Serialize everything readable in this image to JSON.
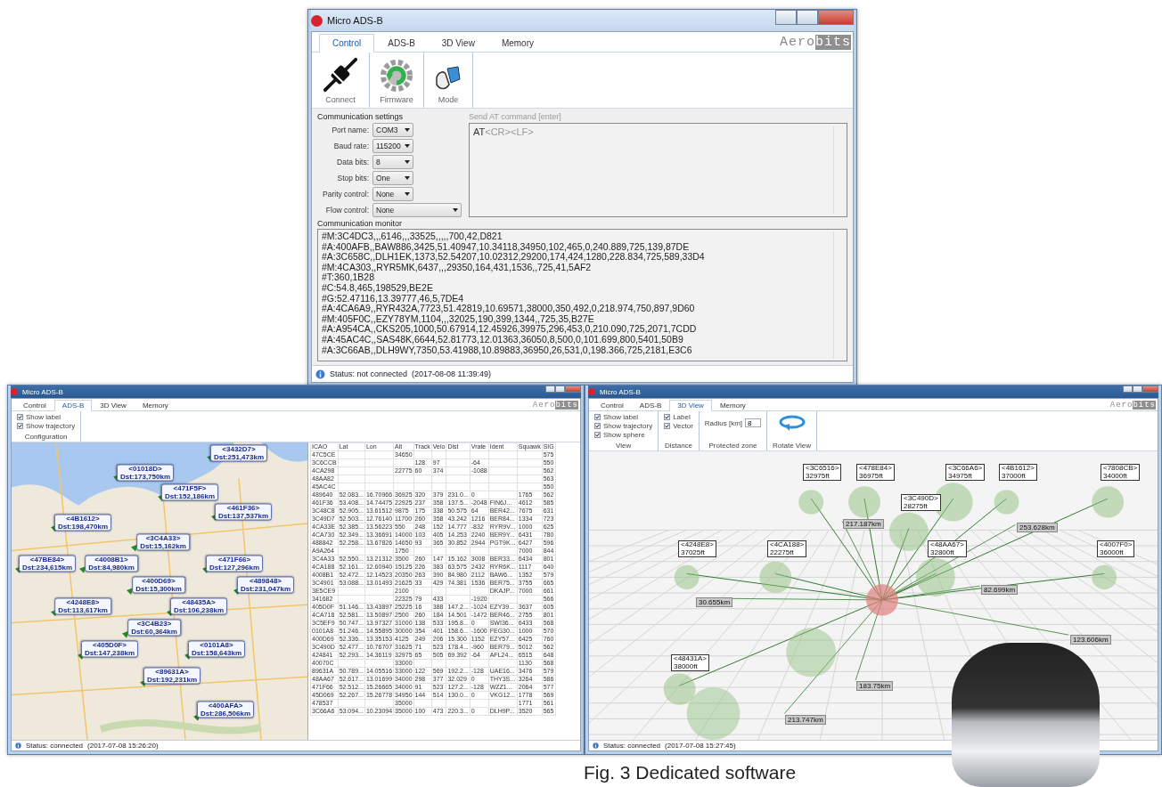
{
  "control_window": {
    "title": "Micro ADS-B",
    "logo": [
      "Aero",
      "bits"
    ],
    "tabs": [
      {
        "label": "Control",
        "selected": true
      },
      {
        "label": "ADS-B",
        "selected": false
      },
      {
        "label": "3D View",
        "selected": false
      },
      {
        "label": "Memory",
        "selected": false
      }
    ],
    "ribbon": [
      {
        "kind": "connect",
        "label": "Connect"
      },
      {
        "kind": "firmware",
        "label": "Firmware"
      },
      {
        "kind": "mode",
        "label": "Mode"
      }
    ],
    "settings_title": "Communication settings",
    "fields": [
      {
        "label": "Port name:",
        "value": "COM3",
        "kind": "narrow"
      },
      {
        "label": "Baud rate:",
        "value": "115200",
        "kind": "narrow"
      },
      {
        "label": "Data bits:",
        "value": "8",
        "kind": "narrow"
      },
      {
        "label": "Stop bits:",
        "value": "One",
        "kind": "narrow"
      },
      {
        "label": "Parity control:",
        "value": "None",
        "kind": "narrow"
      },
      {
        "label": "Flow control:",
        "value": "None",
        "kind": "wide"
      }
    ],
    "at_command": {
      "label": "Send AT command [enter]",
      "value": "AT",
      "suffix": "<CR><LF>"
    },
    "monitor_title": "Communication monitor",
    "monitor_lines": [
      "#M:3C4DC3,,,6146,,,33525,,,,,700,42,D821",
      "#A:400AFB,,BAW886,3425,51.40947,10.34118,34950,102,465,0,240.889,725,139,87DE",
      "#A:3C658C,,DLH1EK,1373,52.54207,10.02312,29200,174,424,1280,228.834,725,589,33D4",
      "#M:4CA303,,RYR5MK,6437,,,29350,164,431,1536,,725,41,5AF2",
      "#T:360,1B28",
      "#C:54.8,465,198529,BE2E",
      "#G:52.47116,13.39777,46,5,7DE4",
      "#A:4CA6A9,,RYR432A,7723,51.42819,10.69571,38000,350,492,0,218.974,750,897,9D60",
      "#M:405F0C,,EZY78YM,1104,,,32025,190,399,1344,,725,35,B27E",
      "#A:A954CA,,CKS205,1000,50.67914,12.45926,39975,296,453,0,210.090,725,2071,7CDD",
      "#A:45AC4C,,SAS48K,6644,52.81773,12.01363,36050,8,500,0,101.699,800,5401,50B9",
      "#A:3C66AB,,DLH9WY,7350,53.41988,10.89883,36950,26,531,0,198.366,725,2181,E3C6"
    ],
    "status": {
      "text": "Status: not connected",
      "time": "(2017-08-08 11:39:49)"
    }
  },
  "map_window": {
    "title": "Micro ADS-B",
    "logo": [
      "Aero",
      "bits"
    ],
    "tabs": [
      {
        "label": "Control",
        "selected": false
      },
      {
        "label": "ADS-B",
        "selected": true
      },
      {
        "label": "3D View",
        "selected": false
      },
      {
        "label": "Memory",
        "selected": false
      }
    ],
    "options": [
      {
        "label": "Show label",
        "checked": true
      },
      {
        "label": "Show trajectory",
        "checked": true
      }
    ],
    "group_label": "Configuration",
    "aircraft": [
      {
        "icao": "<3432D7>",
        "dist": "Dst:251,473km"
      },
      {
        "icao": "<01018D>",
        "dist": "Dst:173,750km"
      },
      {
        "icao": "<471F5F>",
        "dist": "Dst:152,186km"
      },
      {
        "icao": "<461F36>",
        "dist": "Dst:137,537km"
      },
      {
        "icao": "<4B1612>",
        "dist": "Dst:198,470km"
      },
      {
        "icao": "<3C4A33>",
        "dist": "Dst:15,162km"
      },
      {
        "icao": "<47BE84>",
        "dist": "Dst:234,615km"
      },
      {
        "icao": "<4008B1>",
        "dist": "Dst:84,980km"
      },
      {
        "icao": "<471F66>",
        "dist": "Dst:127,296km"
      },
      {
        "icao": "<400D69>",
        "dist": "Dst:15,300km"
      },
      {
        "icao": "<489848>",
        "dist": "Dst:231,047km"
      },
      {
        "icao": "<4248E8>",
        "dist": "Dst:113,617km"
      },
      {
        "icao": "<48435A>",
        "dist": "Dst:106,238km"
      },
      {
        "icao": "<3C4B23>",
        "dist": "Dst:60,364km"
      },
      {
        "icao": "<405D0F>",
        "dist": "Dst:147,238km"
      },
      {
        "icao": "<0101A8>",
        "dist": "Dst:158,643km"
      },
      {
        "icao": "<89631A>",
        "dist": "Dst:192,231km"
      },
      {
        "icao": "<400AFA>",
        "dist": "Dst:286,506km"
      }
    ],
    "table": {
      "columns": [
        "ICAO",
        "Lat",
        "Lon",
        "Alt",
        "Track",
        "Velo",
        "Dist",
        "Vrate",
        "Ident",
        "Squawk",
        "SIG"
      ],
      "rows": [
        [
          "47C5CE",
          "",
          "",
          "34650",
          "",
          "",
          "",
          "",
          "",
          "",
          "575"
        ],
        [
          "3C6CCB",
          "",
          "",
          "",
          "128",
          "97",
          "",
          "-64",
          "",
          "",
          "550"
        ],
        [
          "4CA298",
          "",
          "",
          "22775",
          "60",
          "374",
          "",
          "-1088",
          "",
          "",
          "562"
        ],
        [
          "48AA82",
          "",
          "",
          "",
          "",
          "",
          "",
          "",
          "",
          "",
          "563"
        ],
        [
          "45AC4C",
          "",
          "",
          "",
          "",
          "",
          "",
          "",
          "",
          "",
          "550"
        ],
        [
          "489640",
          "52.083...",
          "16.70966",
          "36925",
          "320",
          "379",
          "231.0...",
          "0",
          "",
          "1765",
          "562"
        ],
        [
          "461F36",
          "53.408...",
          "14.74475",
          "22925",
          "237",
          "358",
          "137.5...",
          "-2048",
          "FIN6J...",
          "4612",
          "585"
        ],
        [
          "3C48C8",
          "52.905...",
          "13.61512",
          "9875",
          "175",
          "338",
          "50.575",
          "64",
          "BER42...",
          "7675",
          "631"
        ],
        [
          "3C49D7",
          "52.503...",
          "12.76140",
          "11700",
          "260",
          "358",
          "43.242",
          "1216",
          "BER84...",
          "1334",
          "723"
        ],
        [
          "4CA33E",
          "52.385...",
          "13.56223",
          "550",
          "248",
          "152",
          "14.777",
          "-832",
          "RYR9V...",
          "1000",
          "625"
        ],
        [
          "4CA730",
          "52.349...",
          "13.36691",
          "14000",
          "103",
          "405",
          "14.253",
          "2240",
          "BER9Y...",
          "6431",
          "780"
        ],
        [
          "488842",
          "52.258...",
          "13.67826",
          "14650",
          "93",
          "365",
          "30.852",
          "2944",
          "PGT9K...",
          "6427",
          "596"
        ],
        [
          "A9A264",
          "",
          "",
          "1750",
          "",
          "",
          "",
          "",
          "",
          "7000",
          "844"
        ],
        [
          "3C4A33",
          "52.550...",
          "13.21312",
          "3500",
          "260",
          "147",
          "15.162",
          "3008",
          "BER33...",
          "6434",
          "801"
        ],
        [
          "4CA188",
          "52.161...",
          "12.60940",
          "15125",
          "226",
          "383",
          "63.575",
          "2432",
          "RYR6K...",
          "1117",
          "640"
        ],
        [
          "4008B1",
          "52.472...",
          "12.14523",
          "20350",
          "263",
          "390",
          "84.980",
          "2112",
          "BAW6...",
          "1352",
          "579"
        ],
        [
          "3C4901",
          "53.088...",
          "13.01493",
          "21625",
          "33",
          "429",
          "74.381",
          "1536",
          "BER75...",
          "3755",
          "665"
        ],
        [
          "3E5CE9",
          "",
          "",
          "2100",
          "",
          "",
          "",
          "",
          "DKAJP...",
          "7000",
          "661"
        ],
        [
          "341682",
          "",
          "",
          "22325",
          "79",
          "433",
          "",
          "-1920",
          "",
          "",
          "566"
        ],
        [
          "405D0F",
          "51.146...",
          "13.43897",
          "25225",
          "16",
          "388",
          "147.2...",
          "-1024",
          "EZY39...",
          "3637",
          "605"
        ],
        [
          "4CA718",
          "52.581...",
          "13.50897",
          "2500",
          "260",
          "184",
          "14.501",
          "-1472",
          "BER46...",
          "2755",
          "801"
        ],
        [
          "3C5EF9",
          "50.747...",
          "13.97327",
          "31000",
          "138",
          "533",
          "195.8...",
          "0",
          "SWI36...",
          "6433",
          "568"
        ],
        [
          "0101A8",
          "51.246...",
          "14.55895",
          "30000",
          "354",
          "401",
          "158.6...",
          "-1600",
          "FEG30...",
          "1000",
          "570"
        ],
        [
          "400D69",
          "52.336...",
          "13.35153",
          "4125",
          "249",
          "206",
          "15.300",
          "1152",
          "EZY57...",
          "6425",
          "760"
        ],
        [
          "3C490D",
          "52.477...",
          "10.76707",
          "31625",
          "71",
          "523",
          "178.4...",
          "-960",
          "BER79...",
          "5012",
          "562"
        ],
        [
          "424841",
          "52.293...",
          "14.36119",
          "32975",
          "65",
          "505",
          "69.392",
          "-64",
          "AFL24...",
          "6515",
          "648"
        ],
        [
          "40070C",
          "",
          "",
          "33000",
          "",
          "",
          "",
          "",
          "",
          "1130",
          "568"
        ],
        [
          "89631A",
          "50.789...",
          "14.05516",
          "33000",
          "122",
          "569",
          "192.2...",
          "-128",
          "UAE16...",
          "3476",
          "579"
        ],
        [
          "48AA67",
          "52.617...",
          "13.01699",
          "34000",
          "298",
          "377",
          "32.029",
          "0",
          "THY3S...",
          "3264",
          "586"
        ],
        [
          "471F66",
          "52.512...",
          "15.26665",
          "34000",
          "91",
          "523",
          "127.2...",
          "-128",
          "WZZ1...",
          "2064",
          "577"
        ],
        [
          "45D069",
          "52.267...",
          "15.26778",
          "34950",
          "144",
          "514",
          "130.0...",
          "0",
          "VKG12...",
          "1778",
          "569"
        ],
        [
          "478537",
          "",
          "",
          "35000",
          "",
          "",
          "",
          "",
          "",
          "1771",
          "561"
        ],
        [
          "3C66A6",
          "53.094...",
          "10.23094",
          "35000",
          "100",
          "473",
          "220.3...",
          "0",
          "DLH9P...",
          "3520",
          "565"
        ]
      ]
    },
    "status": {
      "text": "Status: connected",
      "time": "(2017-07-08 15:26:20)"
    }
  },
  "view_window": {
    "title": "Micro ADS-B",
    "logo": [
      "Aero",
      "bits"
    ],
    "tabs": [
      {
        "label": "Control",
        "selected": false
      },
      {
        "label": "ADS-B",
        "selected": false
      },
      {
        "label": "3D View",
        "selected": true
      },
      {
        "label": "Memory",
        "selected": false
      }
    ],
    "groups": [
      {
        "kind": "checks",
        "label": "View",
        "items": [
          {
            "label": "Show label",
            "checked": true
          },
          {
            "label": "Show trajectory",
            "checked": true
          },
          {
            "label": "Show sphere",
            "checked": true
          }
        ]
      },
      {
        "kind": "checks",
        "label": "Distance",
        "items": [
          {
            "label": "Label",
            "checked": true
          },
          {
            "label": "Vector",
            "checked": true
          }
        ]
      },
      {
        "kind": "field",
        "label": "Protected zone",
        "field_label": "Radius [km]",
        "value": "8"
      },
      {
        "kind": "rotate",
        "label": "Rotate View"
      }
    ],
    "aircraft": [
      {
        "icao": "<3C6516>",
        "alt": "32975ft"
      },
      {
        "icao": "<478E84>",
        "alt": "36975ft"
      },
      {
        "icao": "<3C66A6>",
        "alt": "34975ft"
      },
      {
        "icao": "<4B1612>",
        "alt": "37000ft"
      },
      {
        "icao": "<7808CB>",
        "alt": "34000ft"
      },
      {
        "icao": "<3C490D>",
        "alt": "28275ft"
      },
      {
        "icao": "<4248E8>",
        "alt": "37025ft"
      },
      {
        "icao": "<4CA188>",
        "alt": "22275ft"
      },
      {
        "icao": "<48AA67>",
        "alt": "32800ft"
      },
      {
        "icao": "<4007F0>",
        "alt": "36000ft"
      },
      {
        "icao": "<48431A>",
        "alt": "38000ft"
      }
    ],
    "distances": [
      "217.187km",
      "253.628km",
      "82.699km",
      "30.655km",
      "123.606km",
      "183.75km",
      "213.747km"
    ],
    "status": {
      "text": "Status: connected",
      "time": "(2017-07-08 15:27:45)"
    }
  },
  "caption": "Fig. 3 Dedicated software"
}
